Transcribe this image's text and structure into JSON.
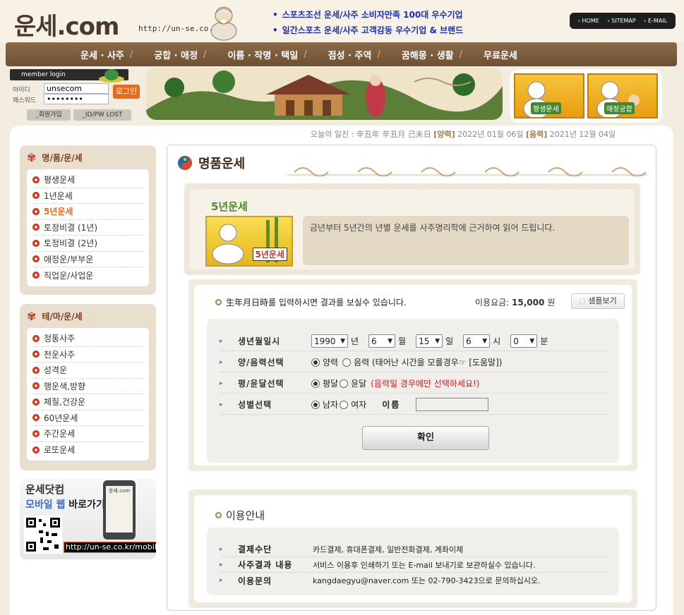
{
  "header": {
    "logo": "운세.com",
    "url": "http://un-se.co.kr",
    "promo": [
      "스포츠조선 운세/사주 소비자만족 100대 우수기업",
      "일간스포츠 운세/사주 고객감동 우수기업 & 브랜드"
    ],
    "toplinks": [
      "HOME",
      "SITEMAP",
      "E-MAIL"
    ]
  },
  "nav": {
    "items": [
      "운세 · 사주",
      "궁합 · 애정",
      "이름 · 작명 · 택일",
      "점성 · 주역",
      "꿈해몽 · 생활",
      "무료운세"
    ]
  },
  "login": {
    "badge": "member login",
    "id_label": "아이디",
    "pw_label": "패스워드",
    "id_value": "unsecom",
    "pw_value": "••••••••",
    "login_button": "로그인",
    "join_button": "_회원가입",
    "lost_button": "_ID/PW LOST"
  },
  "promo_cards": [
    "평생운세",
    "애정궁합"
  ],
  "ilgin": {
    "prefix": "오늘의 일진 : 辛丑年 辛丑月 己未日",
    "solar_label": "[양력]",
    "solar_date": "2022년 01월 06일",
    "lunar_label": "[음력]",
    "lunar_date": "2021년 12월 04일"
  },
  "sidebar": {
    "box1_title": "명/품/운/세",
    "box1_items": [
      "평생운세",
      "1년운세",
      "5년운세",
      "토정비결 (1년)",
      "토정비결 (2년)",
      "애정운/부부운",
      "직업운/사업운"
    ],
    "box2_title": "테/마/운/세",
    "box2_items": [
      "정통사주",
      "천운사주",
      "성격운",
      "행운색,방향",
      "체질,건강운",
      "60년운세",
      "주간운세",
      "로또운세"
    ],
    "mobile": {
      "line1": "운세닷컴",
      "line2a": "모바일 웹",
      "line2b": " 바로가기!",
      "url": "http://un-se.co.kr/mobile",
      "phone_brand": "운세.com"
    }
  },
  "main": {
    "title": "명품운세",
    "intro_title": "5년운세",
    "intro_text": "금년부터 5년간의 년별 운세를 사주명리학에 근거하여 읽어 드립니다.",
    "intro_img_caption": "5년운세",
    "form_head": "生年月日時를 입력하시면 결과를 보실수 있습니다.",
    "fee_label": "이용요금:",
    "fee_value": "15,000",
    "fee_unit": "원",
    "sample_button": "샘플보기",
    "rows": {
      "birth_label": "생년월일시",
      "year": "1990",
      "year_unit": "년",
      "month": "6",
      "month_unit": "월",
      "day": "15",
      "day_unit": "일",
      "hour": "6",
      "hour_unit": "시",
      "minute": "0",
      "minute_unit": "분",
      "calendar_label": "양/음력선택",
      "solar": "양력",
      "lunar": "음력 (태어난 시간을 모를경우☞ [도움말])",
      "leap_label": "평/윤달선택",
      "normal": "평달",
      "leap": "윤달",
      "leap_note": "(음력일 경우에만 선택하세요!)",
      "gender_label": "성별선택",
      "male": "남자",
      "female": "여자",
      "name_label": "이름"
    },
    "confirm_button": "확인",
    "info_title": "이용안내",
    "info_rows": [
      {
        "label": "결제수단",
        "value": "카드결제, 휴대폰결제, 일반전화결제, 계좌이체"
      },
      {
        "label": "사주결과 내용",
        "value": "서비스 이용후 인쇄하기 또는 E-mail 보내기로 보관하실수 있습니다."
      },
      {
        "label": "이용문의",
        "value": "kangdaegyu@naver.com 또는 02-790-3423으로 문의하십시오."
      }
    ]
  },
  "colors": {
    "nav_brown": "#7a5a3c",
    "accent_orange": "#e86b1b",
    "promo_blue": "#1b2fb8",
    "warning_red": "#d41818"
  }
}
